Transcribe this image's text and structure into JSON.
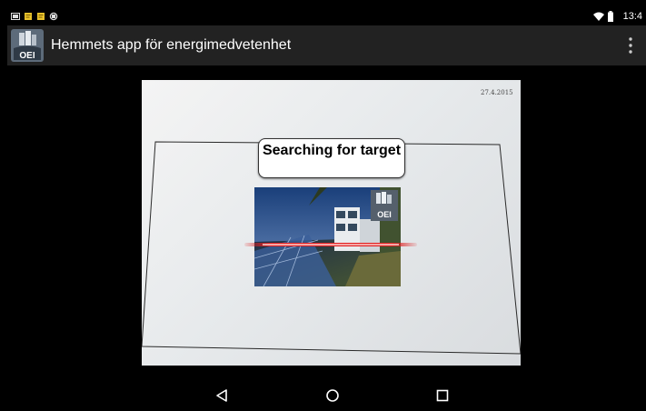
{
  "status_bar": {
    "time": "13:4",
    "left_icons": [
      "screenshot-icon",
      "note-icon",
      "note-icon",
      "sync-icon"
    ],
    "right_icons": [
      "wifi-icon",
      "battery-icon"
    ]
  },
  "app_bar": {
    "title": "Hemmets app för energimedvetenhet",
    "logo_text": "OEI",
    "overflow_icon": "more-vert-icon",
    "color": "#222222"
  },
  "camera_view": {
    "toast": "Searching for target",
    "paper_date": "27.4.2015",
    "target_logo_text": "OEI",
    "scanline_color": "#e02020"
  },
  "nav_bar": {
    "icons": [
      "back-icon",
      "home-icon",
      "recents-icon"
    ]
  }
}
